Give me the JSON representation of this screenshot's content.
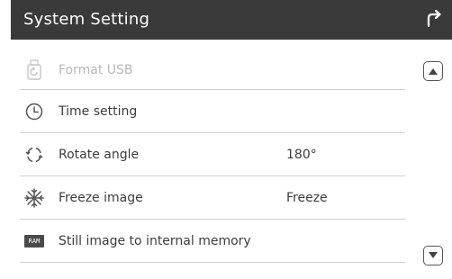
{
  "header": {
    "title": "System Setting",
    "back_icon": "back-arrow-icon"
  },
  "menu": {
    "items": [
      {
        "label": "Format USB",
        "value": "",
        "icon": "usb-format-icon",
        "enabled": false
      },
      {
        "label": "Time setting",
        "value": "",
        "icon": "clock-icon",
        "enabled": true
      },
      {
        "label": "Rotate angle",
        "value": "180°",
        "icon": "rotate-icon",
        "enabled": true
      },
      {
        "label": "Freeze image",
        "value": "Freeze",
        "icon": "snowflake-icon",
        "enabled": true
      },
      {
        "label": "Still image to internal memory",
        "value": "",
        "icon": "ram-icon",
        "enabled": true
      }
    ],
    "ram_icon_text": "RAM"
  },
  "scroll": {
    "up_icon": "triangle-up-icon",
    "down_icon": "triangle-down-icon"
  },
  "colors": {
    "header_bg": "#3a3a3a",
    "text": "#3c3c3c",
    "disabled_text": "#b8b8b8",
    "divider": "#cfcfcf"
  }
}
